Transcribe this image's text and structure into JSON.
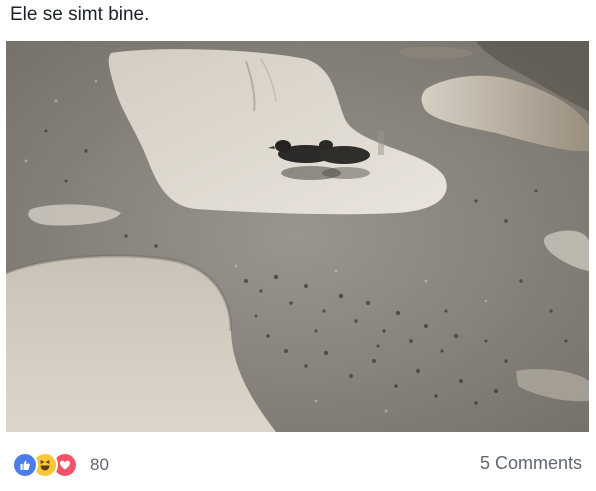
{
  "post": {
    "caption": "Ele se simt bine."
  },
  "photo": {
    "subject": "ducks floating in a water-filled pothole on a gravel road",
    "palette": "grayscale"
  },
  "reactions": {
    "types": [
      "like-icon",
      "haha-icon",
      "love-icon"
    ],
    "count": "80"
  },
  "comments": {
    "label": "5 Comments"
  },
  "colors": {
    "like": "#4a7dea",
    "haha": "#f7c639",
    "love": "#f2526a",
    "muted_text": "#606770",
    "text": "#1d2129"
  }
}
